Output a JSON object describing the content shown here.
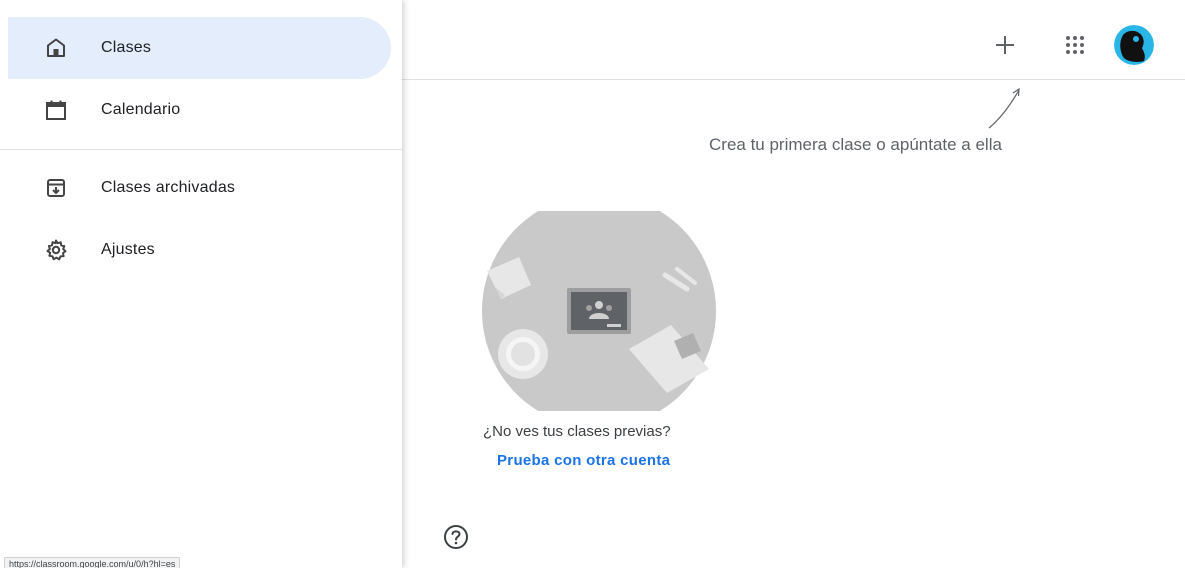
{
  "sidebar": {
    "items": [
      {
        "label": "Clases",
        "icon": "home-icon",
        "active": true
      },
      {
        "label": "Calendario",
        "icon": "calendar-icon",
        "active": false
      },
      {
        "label": "Clases archivadas",
        "icon": "archive-icon",
        "active": false
      },
      {
        "label": "Ajustes",
        "icon": "gear-icon",
        "active": false
      }
    ]
  },
  "status_bar": {
    "url": "https://classroom.google.com/u/0/h?hl=es"
  },
  "topbar": {
    "icons": [
      "plus-icon",
      "apps-grid-icon",
      "avatar"
    ]
  },
  "main": {
    "hint": "Crea tu primera clase o apúntate a ella",
    "question": "¿No ves tus clases previas?",
    "link": "Prueba con otra cuenta"
  },
  "colors": {
    "active_nav": "#e3edfb",
    "link": "#1a73e8",
    "text": "#3c4043",
    "illustration_circle": "#c9c9c9"
  }
}
